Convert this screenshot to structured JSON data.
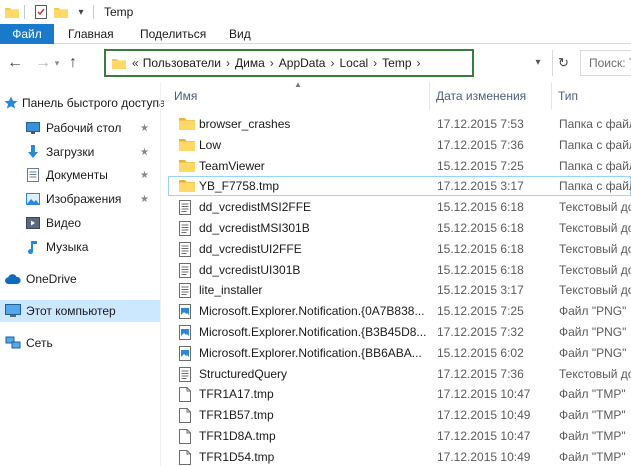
{
  "window": {
    "title": "Temp"
  },
  "ribbon": {
    "tabs": [
      {
        "label": "Файл",
        "active": true
      },
      {
        "label": "Главная"
      },
      {
        "label": "Поделиться"
      },
      {
        "label": "Вид"
      }
    ]
  },
  "address": {
    "overflow": "«",
    "crumbs": [
      "Пользователи",
      "Дима",
      "AppData",
      "Local",
      "Temp"
    ]
  },
  "search": {
    "placeholder": "Поиск: Temp"
  },
  "navpane": {
    "quick_access": "Панель быстрого доступа",
    "items": [
      {
        "label": "Рабочий стол",
        "icon": "desktop-icon",
        "pinned": true
      },
      {
        "label": "Загрузки",
        "icon": "downloads-icon",
        "pinned": true
      },
      {
        "label": "Документы",
        "icon": "documents-icon",
        "pinned": true
      },
      {
        "label": "Изображения",
        "icon": "pictures-icon",
        "pinned": true
      },
      {
        "label": "Видео",
        "icon": "videos-icon",
        "pinned": false
      },
      {
        "label": "Музыка",
        "icon": "music-icon",
        "pinned": false
      }
    ],
    "onedrive": "OneDrive",
    "this_pc": "Этот компьютер",
    "network": "Сеть",
    "pin_glyph": "★"
  },
  "columns": {
    "name": "Имя",
    "date": "Дата изменения",
    "type": "Тип"
  },
  "files": [
    {
      "name": "browser_crashes",
      "date": "17.12.2015 7:53",
      "type": "Папка с файлами",
      "icon": "folder"
    },
    {
      "name": "Low",
      "date": "17.12.2015 7:36",
      "type": "Папка с файлами",
      "icon": "folder"
    },
    {
      "name": "TeamViewer",
      "date": "15.12.2015 7:25",
      "type": "Папка с файлами",
      "icon": "folder"
    },
    {
      "name": "YB_F7758.tmp",
      "date": "17.12.2015 3:17",
      "type": "Папка с файлами",
      "icon": "folder",
      "outlined": true
    },
    {
      "name": "dd_vcredistMSI2FFE",
      "date": "15.12.2015 6:18",
      "type": "Текстовый документ",
      "icon": "text"
    },
    {
      "name": "dd_vcredistMSI301B",
      "date": "15.12.2015 6:18",
      "type": "Текстовый документ",
      "icon": "text"
    },
    {
      "name": "dd_vcredistUI2FFE",
      "date": "15.12.2015 6:18",
      "type": "Текстовый документ",
      "icon": "text"
    },
    {
      "name": "dd_vcredistUI301B",
      "date": "15.12.2015 6:18",
      "type": "Текстовый документ",
      "icon": "text"
    },
    {
      "name": "lite_installer",
      "date": "15.12.2015 3:17",
      "type": "Текстовый документ",
      "icon": "text"
    },
    {
      "name": "Microsoft.Explorer.Notification.{0A7B838...",
      "date": "15.12.2015 7:25",
      "type": "Файл \"PNG\"",
      "icon": "image"
    },
    {
      "name": "Microsoft.Explorer.Notification.{B3B45D8...",
      "date": "17.12.2015 7:32",
      "type": "Файл \"PNG\"",
      "icon": "image"
    },
    {
      "name": "Microsoft.Explorer.Notification.{BB6ABA...",
      "date": "15.12.2015 6:02",
      "type": "Файл \"PNG\"",
      "icon": "image"
    },
    {
      "name": "StructuredQuery",
      "date": "17.12.2015 7:36",
      "type": "Текстовый документ",
      "icon": "text"
    },
    {
      "name": "TFR1A17.tmp",
      "date": "17.12.2015 10:47",
      "type": "Файл \"TMP\"",
      "icon": "blank"
    },
    {
      "name": "TFR1B57.tmp",
      "date": "17.12.2015 10:49",
      "type": "Файл \"TMP\"",
      "icon": "blank"
    },
    {
      "name": "TFR1D8A.tmp",
      "date": "17.12.2015 10:47",
      "type": "Файл \"TMP\"",
      "icon": "blank"
    },
    {
      "name": "TFR1D54.tmp",
      "date": "17.12.2015 10:49",
      "type": "Файл \"TMP\"",
      "icon": "blank"
    }
  ],
  "colors": {
    "file_tab": "#1979ca",
    "address_border": "#3a7d3a",
    "selected_nav": "#cce8ff",
    "folder": "#f3ca4f"
  }
}
